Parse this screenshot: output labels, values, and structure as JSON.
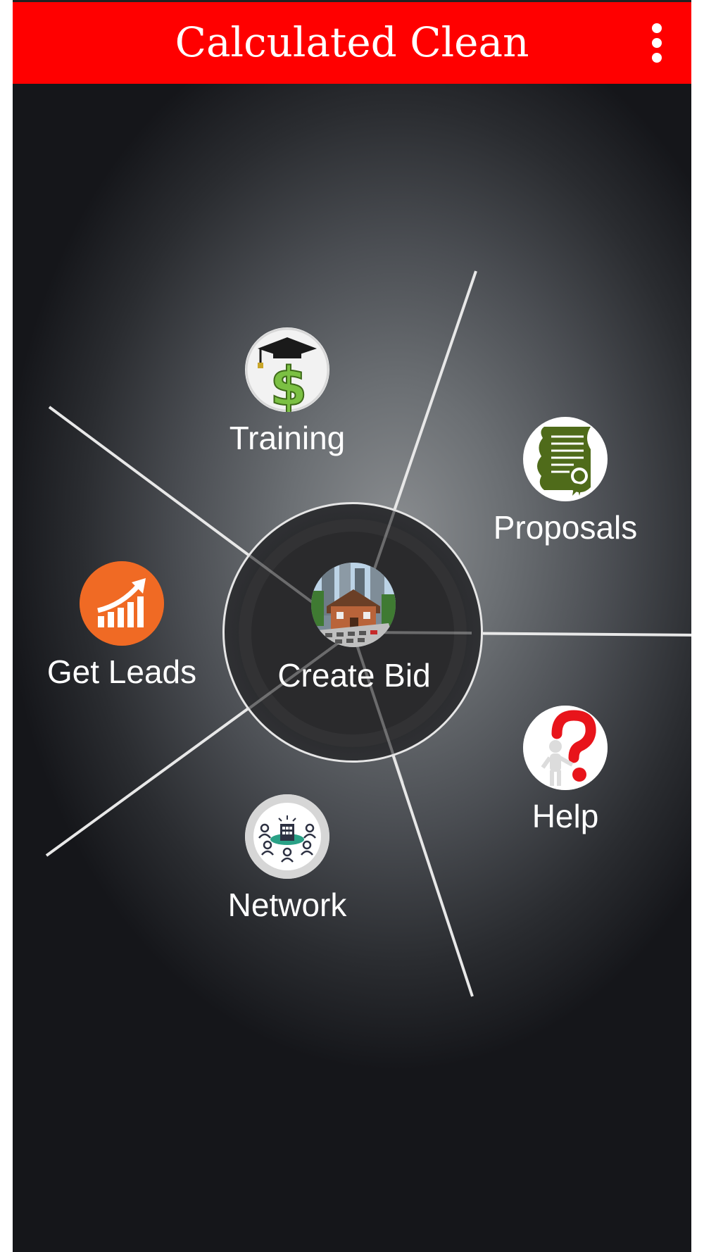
{
  "app_bar": {
    "title": "Calculated Clean",
    "menu_icon": "more-vert-icon"
  },
  "menu": {
    "training": {
      "label": "Training",
      "icon": "graduation-dollar-icon"
    },
    "proposals": {
      "label": "Proposals",
      "icon": "certificate-scroll-icon"
    },
    "get_leads": {
      "label": "Get Leads",
      "icon": "growth-chart-icon"
    },
    "create_bid": {
      "label": "Create Bid",
      "icon": "house-calculator-icon"
    },
    "help": {
      "label": "Help",
      "icon": "question-mark-figure-icon"
    },
    "network": {
      "label": "Network",
      "icon": "people-network-icon"
    }
  },
  "colors": {
    "app_bar": "#ff0000",
    "leads_orange": "#f06a24",
    "proposals_green": "#4f6b1a",
    "training_green": "#7bc043",
    "help_red": "#e8141b",
    "network_teal": "#2aa186"
  }
}
